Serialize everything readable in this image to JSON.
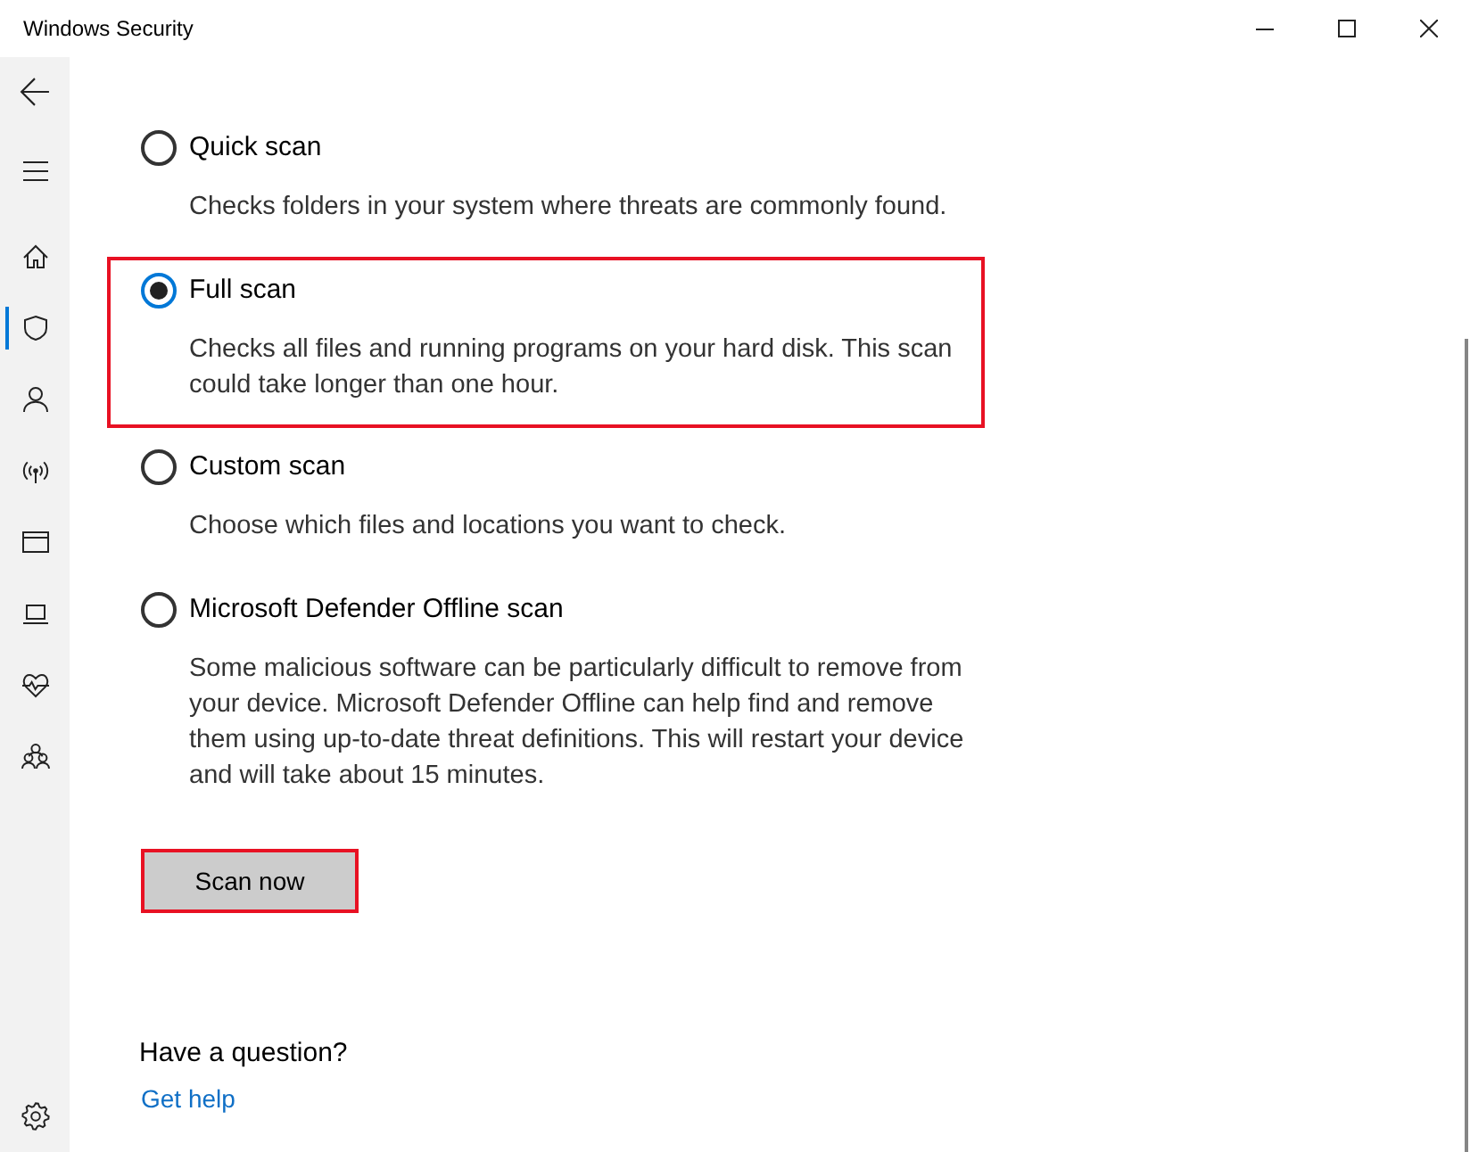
{
  "window": {
    "title": "Windows Security"
  },
  "sidebar": {
    "items": [
      {
        "selected": false
      },
      {
        "selected": true
      },
      {
        "selected": false
      },
      {
        "selected": false
      },
      {
        "selected": false
      },
      {
        "selected": false
      },
      {
        "selected": false
      },
      {
        "selected": false
      }
    ]
  },
  "scan_options": [
    {
      "label": "Quick scan",
      "description": "Checks folders in your system where threats are commonly found.",
      "selected": false,
      "highlighted": false
    },
    {
      "label": "Full scan",
      "description": "Checks all files and running programs on your hard disk. This scan could take longer than one hour.",
      "selected": true,
      "highlighted": true
    },
    {
      "label": "Custom scan",
      "description": "Choose which files and locations you want to check.",
      "selected": false,
      "highlighted": false
    },
    {
      "label": "Microsoft Defender Offline scan",
      "description": "Some malicious software can be particularly difficult to remove from your device. Microsoft Defender Offline can help find and remove them using up-to-date threat definitions. This will restart your device and will take about 15 minutes.",
      "selected": false,
      "highlighted": false
    }
  ],
  "scan_button": {
    "label": "Scan now",
    "highlighted": true
  },
  "help": {
    "heading": "Have a question?",
    "link": "Get help"
  }
}
